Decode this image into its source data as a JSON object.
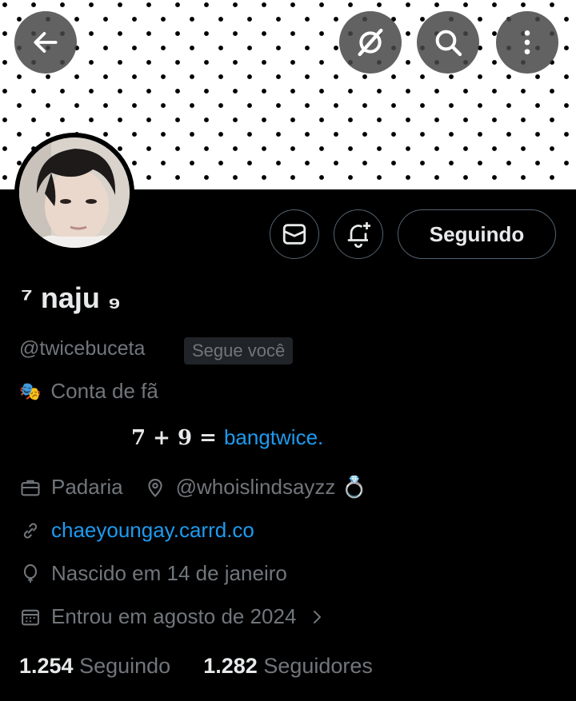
{
  "header": {
    "back_icon": "arrow-left-icon",
    "grok_icon": "grok-icon",
    "search_icon": "search-icon",
    "more_icon": "more-vertical-icon"
  },
  "profile": {
    "display_name_prefix": "⁷",
    "display_name": "naju",
    "display_name_suffix": "₉",
    "handle": "@twicebuceta",
    "follows_you": "Segue você",
    "follow_button": "Seguindo",
    "category_emoji": "🎭",
    "category": "Conta de fã",
    "bio_serif": "𝟕 + 𝟗 = ",
    "bio_link": "bangtwice.",
    "job": "Padaria",
    "location": "@whoislindsayzz 💍",
    "website": "chaeyoungay.carrd.co",
    "birthday": "Nascido em 14 de janeiro",
    "joined": "Entrou em agosto de 2024"
  },
  "stats": {
    "following_count": "1.254",
    "following_label": "Seguindo",
    "followers_count": "1.282",
    "followers_label": "Seguidores"
  },
  "colors": {
    "background": "#000000",
    "text": "#e7e9ea",
    "muted": "#71767b",
    "link": "#1d9bf0",
    "border": "#536471"
  }
}
